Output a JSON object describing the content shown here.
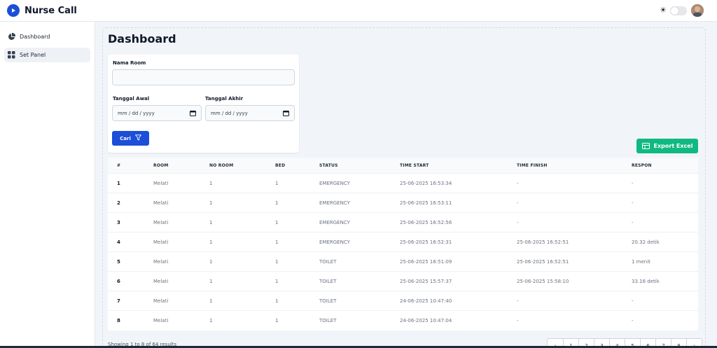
{
  "app": {
    "title": "Nurse Call"
  },
  "theme_toggle": {
    "icon": "sun-icon",
    "state": "off"
  },
  "sidebar": {
    "items": [
      {
        "label": "Dashboard",
        "icon": "pie-chart-icon",
        "active": false
      },
      {
        "label": "Set Panel",
        "icon": "grid-icon",
        "active": true
      }
    ]
  },
  "page": {
    "title": "Dashboard"
  },
  "filter": {
    "nama_room_label": "Nama Room",
    "nama_room_value": "",
    "tanggal_awal_label": "Tanggal Awal",
    "tanggal_awal_placeholder": "mm / dd / yyyy",
    "tanggal_akhir_label": "Tanggal Akhir",
    "tanggal_akhir_placeholder": "mm / dd / yyyy",
    "cari_label": "Cari"
  },
  "export": {
    "label": "Export Excel"
  },
  "table": {
    "headers": [
      "#",
      "ROOM",
      "NO ROOM",
      "BED",
      "STATUS",
      "TIME START",
      "TIME FINISH",
      "RESPON"
    ],
    "rows": [
      [
        "1",
        "Melati",
        "1",
        "1",
        "EMERGENCY",
        "25-06-2025 16:53:34",
        "-",
        "-"
      ],
      [
        "2",
        "Melati",
        "1",
        "1",
        "EMERGENCY",
        "25-06-2025 16:53:11",
        "-",
        "-"
      ],
      [
        "3",
        "Melati",
        "1",
        "1",
        "EMERGENCY",
        "25-06-2025 16:52:56",
        "-",
        "-"
      ],
      [
        "4",
        "Melati",
        "1",
        "1",
        "EMERGENCY",
        "25-06-2025 16:52:31",
        "25-06-2025 16:52:51",
        "20.32 detik"
      ],
      [
        "5",
        "Melati",
        "1",
        "1",
        "TOILET",
        "25-06-2025 16:51:09",
        "25-06-2025 16:52:51",
        "1 menit"
      ],
      [
        "6",
        "Melati",
        "1",
        "1",
        "TOILET",
        "25-06-2025 15:57:37",
        "25-06-2025 15:58:10",
        "33.16 detik"
      ],
      [
        "7",
        "Melati",
        "1",
        "1",
        "TOILET",
        "24-06-2025 10:47:40",
        "-",
        "-"
      ],
      [
        "8",
        "Melati",
        "1",
        "1",
        "TOILET",
        "24-06-2025 10:47:04",
        "-",
        "-"
      ]
    ]
  },
  "pagination": {
    "summary": "Showing 1 to 8 of 64 results",
    "prev": "‹",
    "pages": [
      "1",
      "2",
      "3",
      "4",
      "5",
      "6",
      "7",
      "8"
    ],
    "next": "›"
  },
  "colors": {
    "brand": "#1d4ed8",
    "export": "#10b981",
    "background": "#f1f5f9"
  }
}
